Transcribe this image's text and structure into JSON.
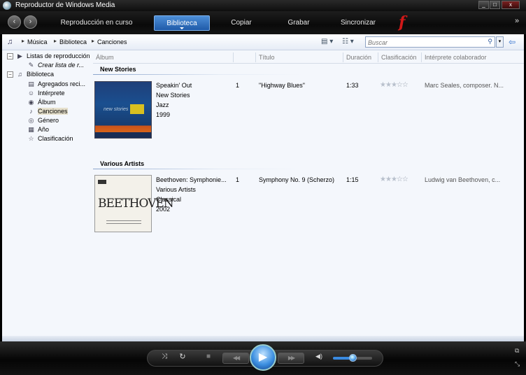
{
  "window": {
    "title": "Reproductor de Windows Media",
    "buttons": {
      "minimize": "_",
      "maximize": "□",
      "close": "x"
    }
  },
  "nav": {
    "back": "‹",
    "forward": "›",
    "tabs": [
      {
        "label": "Reproducción en curso",
        "active": false
      },
      {
        "label": "Biblioteca",
        "active": true
      },
      {
        "label": "Copiar",
        "active": false
      },
      {
        "label": "Grabar",
        "active": false
      },
      {
        "label": "Sincronizar",
        "active": false
      }
    ],
    "logo": "f",
    "more": "»"
  },
  "breadcrumb": {
    "items": [
      "Música",
      "Biblioteca",
      "Canciones"
    ]
  },
  "search": {
    "placeholder": "Buscar"
  },
  "tree": {
    "playlists": {
      "label": "Listas de reproducción",
      "create": "Crear lista de r..."
    },
    "library": {
      "label": "Biblioteca",
      "items": [
        {
          "label": "Agregados reci...",
          "icon": "recent-icon",
          "glyph": "▤"
        },
        {
          "label": "Intérprete",
          "icon": "artist-icon",
          "glyph": "☺"
        },
        {
          "label": "Álbum",
          "icon": "album-icon",
          "glyph": "◉"
        },
        {
          "label": "Canciones",
          "icon": "song-icon",
          "glyph": "♪",
          "selected": true
        },
        {
          "label": "Género",
          "icon": "genre-icon",
          "glyph": "◎"
        },
        {
          "label": "Año",
          "icon": "year-icon",
          "glyph": "▦"
        },
        {
          "label": "Clasificación",
          "icon": "rating-icon",
          "glyph": "☆"
        }
      ]
    }
  },
  "columns": [
    "Álbum",
    "Título",
    "Duración",
    "Clasificación",
    "Intérprete colaborador"
  ],
  "groups": [
    {
      "artist": "New Stories",
      "album": "Speakin' Out",
      "album_artist": "New Stories",
      "genre": "Jazz",
      "year": "1999",
      "track": "1",
      "title": "\"Highway Blues\"",
      "duration": "1:33",
      "rating": 3,
      "contributing": "Marc Seales, composer. N...",
      "cover_text": "new stories"
    },
    {
      "artist": "Various Artists",
      "album": "Beethoven: Symphonie...",
      "album_artist": "Various Artists",
      "genre": "Classical",
      "year": "2002",
      "track": "1",
      "title": "Symphony No. 9 (Scherzo)",
      "duration": "1:15",
      "rating": 3,
      "contributing": "Ludwig van Beethoven, c...",
      "cover_text": "BEETHOVEN"
    }
  ],
  "player": {
    "shuffle": "⤨",
    "repeat": "↻",
    "stop": "■",
    "previous": "◀◀",
    "play": "▶",
    "next": "▶▶",
    "mute": "◀)",
    "volume": 0.5
  },
  "colors": {
    "accent": "#2e6fc6",
    "background": "#f4f7fc",
    "chrome": "#0e0e0e"
  }
}
